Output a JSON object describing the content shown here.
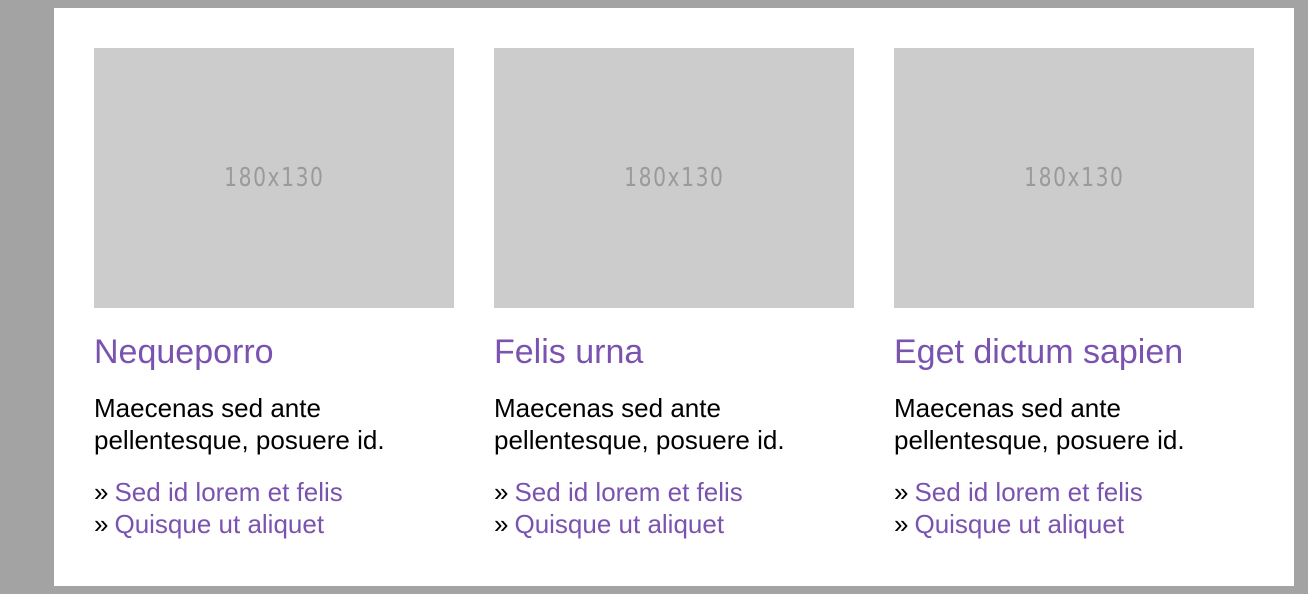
{
  "colors": {
    "background": "#a3a3a3",
    "panel": "#ffffff",
    "placeholder": "#cccccc",
    "accent": "#7a52b0",
    "text": "#000000"
  },
  "cards": [
    {
      "image_label": "180x130",
      "title": "Nequeporro",
      "text": "Maecenas sed ante pellentesque, posuere id.",
      "links": [
        {
          "arrow": "»",
          "label": "Sed id lorem et felis"
        },
        {
          "arrow": "»",
          "label": "Quisque ut aliquet"
        }
      ]
    },
    {
      "image_label": "180x130",
      "title": "Felis urna",
      "text": "Maecenas sed ante pellentesque, posuere id.",
      "links": [
        {
          "arrow": "»",
          "label": "Sed id lorem et felis"
        },
        {
          "arrow": "»",
          "label": "Quisque ut aliquet"
        }
      ]
    },
    {
      "image_label": "180x130",
      "title": "Eget dictum sapien",
      "text": "Maecenas sed ante pellentesque, posuere id.",
      "links": [
        {
          "arrow": "»",
          "label": "Sed id lorem et felis"
        },
        {
          "arrow": "»",
          "label": "Quisque ut aliquet"
        }
      ]
    }
  ]
}
